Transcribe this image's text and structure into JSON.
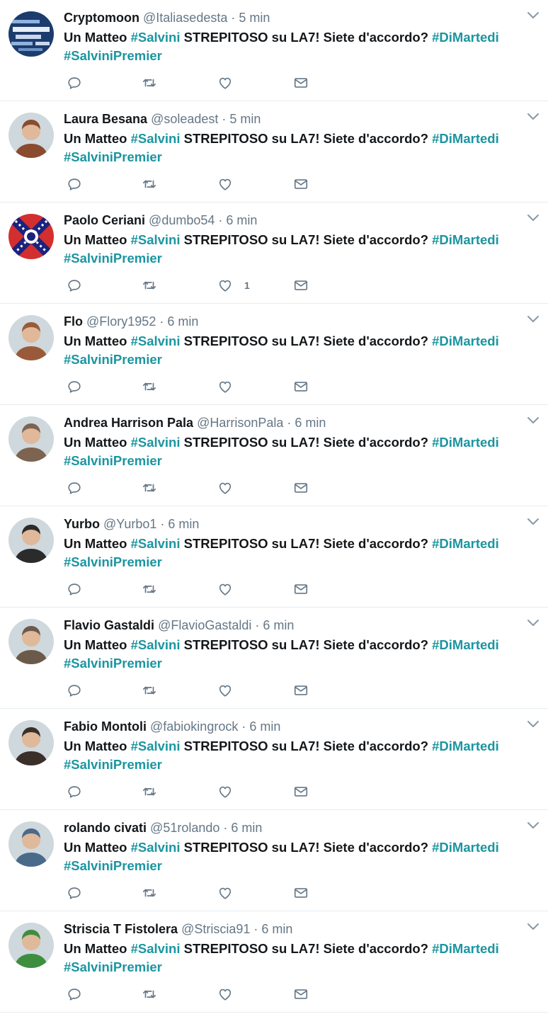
{
  "tweets": [
    {
      "name": "Cryptomoon",
      "handle": "@Italiasedesta",
      "time": "5 min",
      "likes": "",
      "avatar_color": "#1d3c6e",
      "avatar_icon": "blockchain-word-cloud"
    },
    {
      "name": "Laura Besana",
      "handle": "@soleadest",
      "time": "5 min",
      "likes": "",
      "avatar_color": "#8a4b2f",
      "avatar_icon": "user-photo"
    },
    {
      "name": "Paolo Ceriani",
      "handle": "@dumbo54",
      "time": "6 min",
      "likes": "1",
      "avatar_color": "#c62828",
      "avatar_icon": "flag-emblem"
    },
    {
      "name": "Flo",
      "handle": "@Flory1952",
      "time": "6 min",
      "likes": "",
      "avatar_color": "#9a5a3a",
      "avatar_icon": "user-photo"
    },
    {
      "name": "Andrea Harrison Pala",
      "handle": "@HarrisonPala",
      "time": "6 min",
      "likes": "",
      "avatar_color": "#7d6450",
      "avatar_icon": "user-photo"
    },
    {
      "name": "Yurbo",
      "handle": "@Yurbo1",
      "time": "6 min",
      "likes": "",
      "avatar_color": "#2b2b2b",
      "avatar_icon": "user-photo"
    },
    {
      "name": "Flavio Gastaldi",
      "handle": "@FlavioGastaldi",
      "time": "6 min",
      "likes": "",
      "avatar_color": "#6b5a4a",
      "avatar_icon": "user-photo"
    },
    {
      "name": "Fabio Montoli",
      "handle": "@fabiokingrock",
      "time": "6 min",
      "likes": "",
      "avatar_color": "#3b2f2a",
      "avatar_icon": "user-photo"
    },
    {
      "name": "rolando civati",
      "handle": "@51rolando",
      "time": "6 min",
      "likes": "",
      "avatar_color": "#4a6a8a",
      "avatar_icon": "user-photo"
    },
    {
      "name": "Striscia T Fistolera",
      "handle": "@Striscia91",
      "time": "6 min",
      "likes": "",
      "avatar_color": "#3e8e3e",
      "avatar_icon": "user-photo"
    }
  ],
  "tweet_text": {
    "part1": "Un Matteo ",
    "tag1": "#Salvini",
    "part2": " STREPITOSO su LA7! Siete d'accordo? ",
    "tag2": "#DiMartedi",
    "tag3": "#SalviniPremier"
  },
  "separator": " · ",
  "icons": {
    "reply": "reply-icon",
    "retweet": "retweet-icon",
    "like": "heart-icon",
    "dm": "mail-icon",
    "more": "chevron-down-icon"
  },
  "colors": {
    "hashtag": "#1b95a0",
    "muted": "#657786",
    "text": "#14171a",
    "divider": "#e6ecf0"
  }
}
